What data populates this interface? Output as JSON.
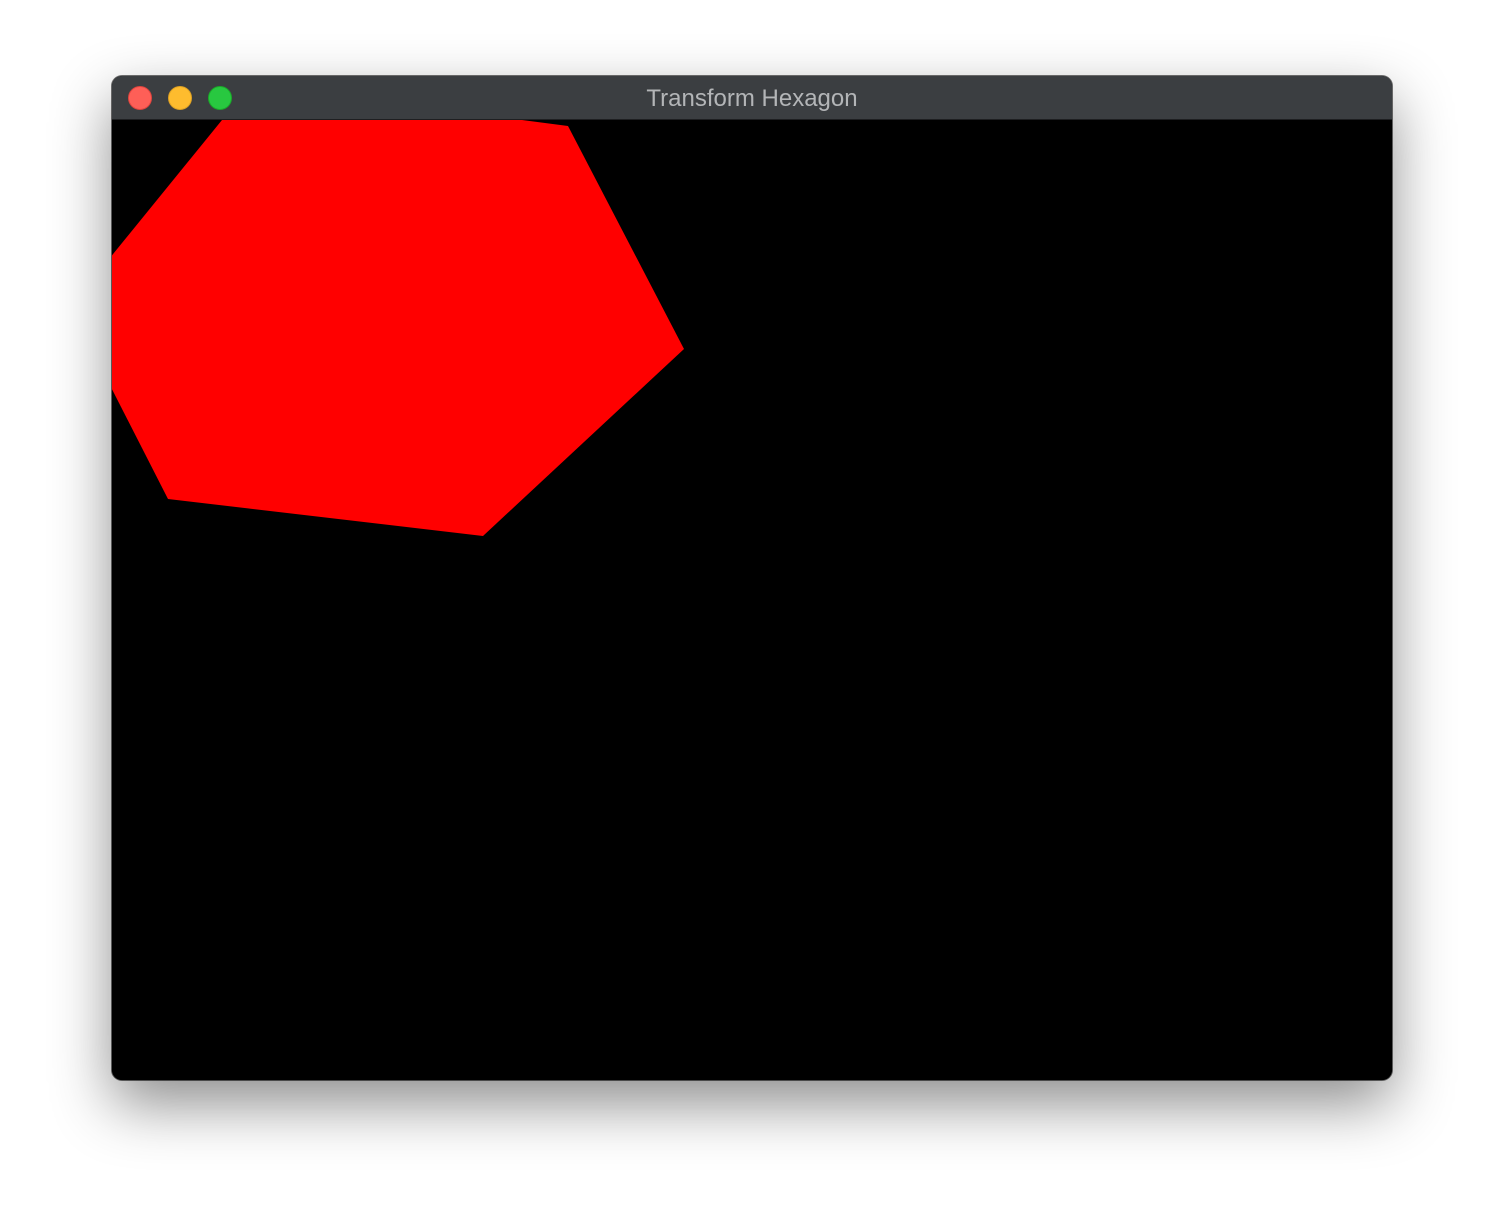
{
  "window": {
    "title": "Transform Hexagon",
    "controls": {
      "close_color": "#fe5f57",
      "minimize_color": "#febc2e",
      "zoom_color": "#28c840"
    }
  },
  "canvas": {
    "background_color": "#000000",
    "shape": {
      "type": "hexagon",
      "fill_color": "#ff0000"
    }
  }
}
